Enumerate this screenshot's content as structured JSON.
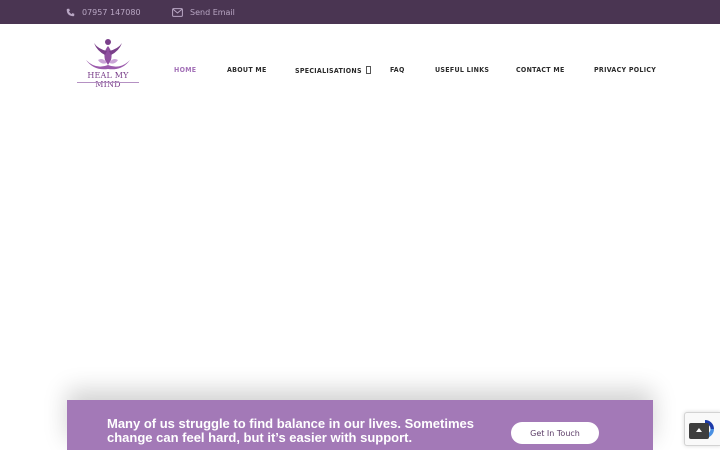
{
  "topbar": {
    "phone": "07957 147080",
    "email": "Send Email",
    "phone_icon": "phone-icon",
    "email_icon": "envelope-icon"
  },
  "brand": {
    "name": "HEAL MY MIND",
    "logo_icon": "lotus-figure-icon"
  },
  "nav": {
    "home": "HOME",
    "about": "ABOUT ME",
    "specialisations": "SPECIALISATIONS",
    "specialisations_caret": "chevron-down-icon",
    "faq": "FAQ",
    "links": "USEFUL LINKS",
    "contact": "CONTACT ME",
    "privacy": "PRIVACY POLICY"
  },
  "cta": {
    "text": "Many of us struggle to find balance in our lives.  Sometimes change can feel hard, but it’s easier with support.",
    "button": "Get In Touch"
  },
  "widgets": {
    "recaptcha_icon": "recaptcha-icon",
    "back_to_top_icon": "arrow-up-icon"
  },
  "colors": {
    "topbar_bg": "#4a3552",
    "accent": "#a472b8",
    "cta_bg": "#a379b7",
    "nav_text": "#2b2b2b"
  }
}
